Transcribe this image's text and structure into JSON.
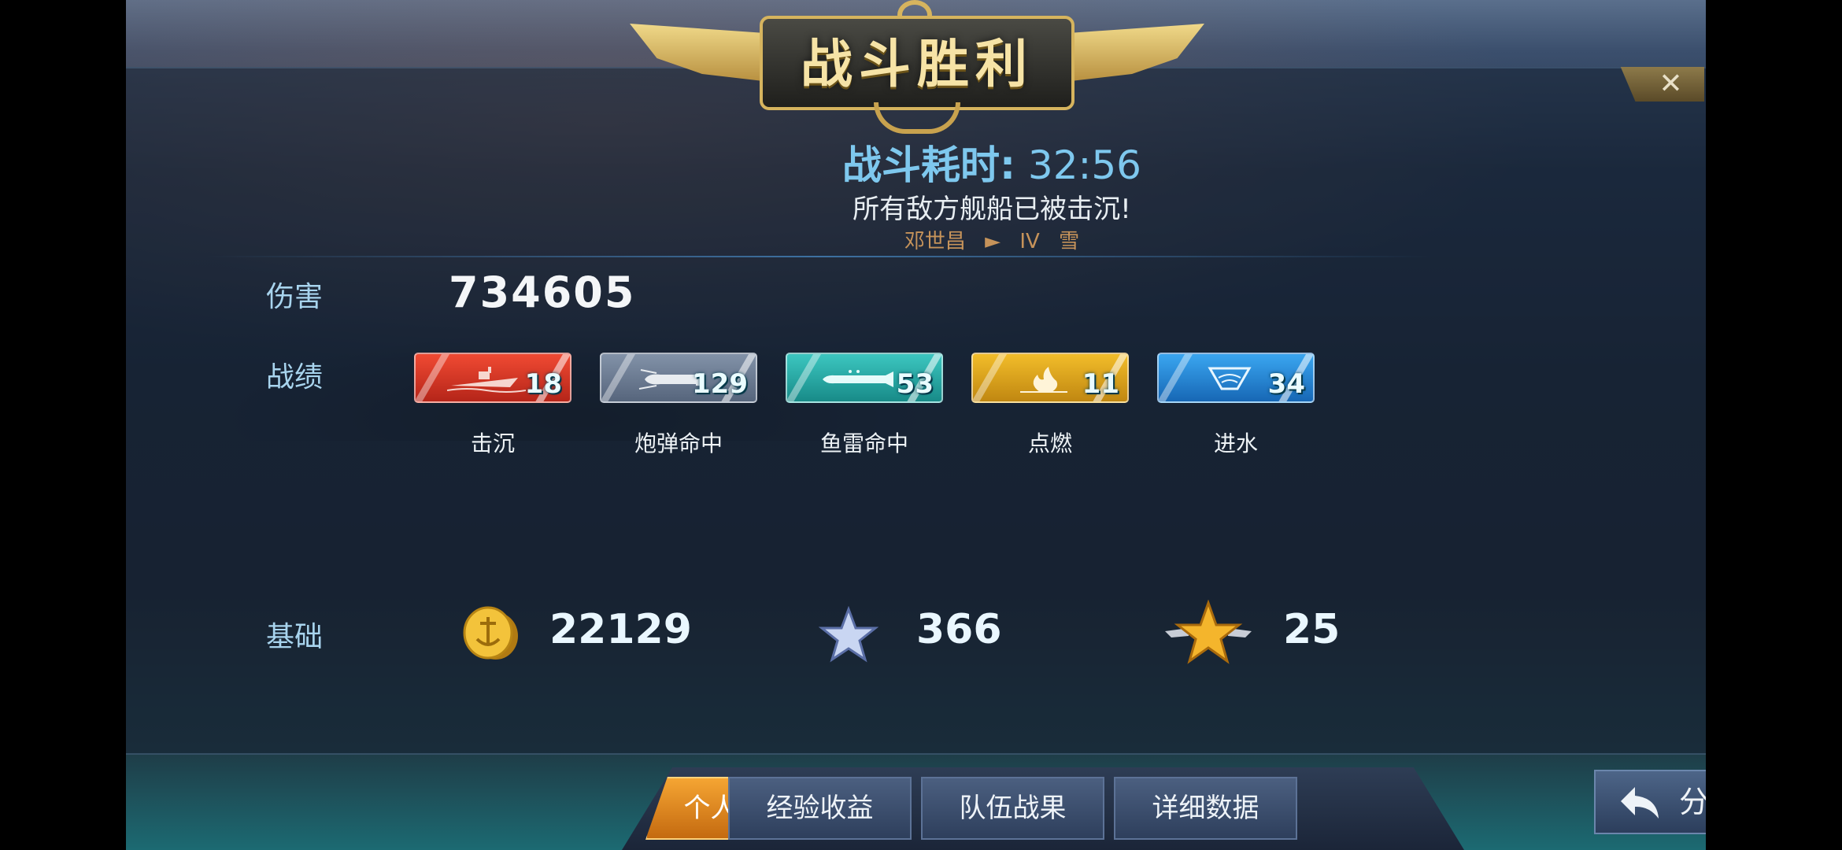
{
  "header": {
    "title": "战斗胜利",
    "close_symbol": "✕",
    "battle_time_label": "战斗耗时:",
    "battle_time_value": "32:56",
    "result_message": "所有敌方舰船已被击沉!",
    "ship_line": {
      "captain": "邓世昌",
      "rank": "IV",
      "ship": "雪"
    }
  },
  "damage": {
    "label": "伤害",
    "value": "734605"
  },
  "record": {
    "label": "战绩",
    "stats": [
      {
        "name": "击沉",
        "count": "18",
        "color": "#d8392a",
        "icon": "ship-sink-icon"
      },
      {
        "name": "炮弹命中",
        "count": "129",
        "color": "#6f7f96",
        "icon": "shell-icon"
      },
      {
        "name": "鱼雷命中",
        "count": "53",
        "color": "#21a9a6",
        "icon": "torpedo-icon"
      },
      {
        "name": "点燃",
        "count": "11",
        "color": "#d9a01a",
        "icon": "fire-icon"
      },
      {
        "name": "进水",
        "count": "34",
        "color": "#1c8ad6",
        "icon": "flood-icon"
      }
    ]
  },
  "base": {
    "label": "基础",
    "coins": "22129",
    "experience": "366",
    "rank_points": "25"
  },
  "tabs": [
    {
      "label": "个人战果",
      "active": true
    },
    {
      "label": "经验收益",
      "active": false
    },
    {
      "label": "队伍战果",
      "active": false
    },
    {
      "label": "详细数据",
      "active": false
    }
  ],
  "share": {
    "label": "分享",
    "icon": "share-back-arrow-icon"
  }
}
